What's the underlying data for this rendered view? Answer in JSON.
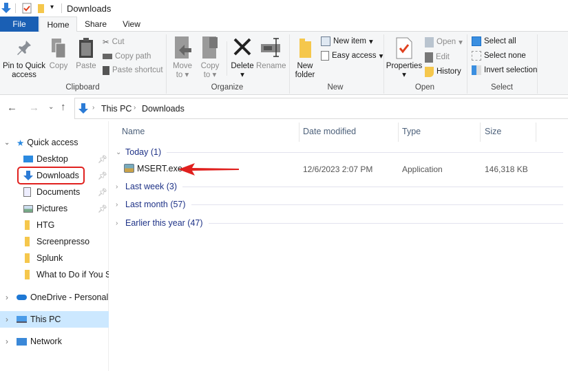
{
  "window": {
    "title": "Downloads"
  },
  "tabs": [
    {
      "label": "File"
    },
    {
      "label": "Home"
    },
    {
      "label": "Share"
    },
    {
      "label": "View"
    }
  ],
  "ribbon": {
    "clipboard": {
      "label": "Clipboard",
      "pin": "Pin to Quick access",
      "pin_l1": "Pin to Quick",
      "pin_l2": "access",
      "copy": "Copy",
      "paste": "Paste",
      "cut": "Cut",
      "copy_path": "Copy path",
      "paste_shortcut": "Paste shortcut"
    },
    "organize": {
      "label": "Organize",
      "move_to_l1": "Move",
      "move_to_l2": "to",
      "copy_to_l1": "Copy",
      "copy_to_l2": "to",
      "delete": "Delete",
      "rename": "Rename"
    },
    "new": {
      "label": "New",
      "new_folder_l1": "New",
      "new_folder_l2": "folder",
      "new_item": "New item",
      "easy_access": "Easy access"
    },
    "open": {
      "label": "Open",
      "properties": "Properties",
      "open": "Open",
      "edit": "Edit",
      "history": "History"
    },
    "select": {
      "label": "Select",
      "select_all": "Select all",
      "select_none": "Select none",
      "invert": "Invert selection"
    }
  },
  "address": {
    "crumbs": [
      "This PC",
      "Downloads"
    ]
  },
  "nav": {
    "quick_access": "Quick access",
    "items": [
      {
        "label": "Desktop",
        "pinned": true
      },
      {
        "label": "Downloads",
        "pinned": true
      },
      {
        "label": "Documents",
        "pinned": true
      },
      {
        "label": "Pictures",
        "pinned": true
      },
      {
        "label": "HTG"
      },
      {
        "label": "Screenpresso"
      },
      {
        "label": "Splunk"
      },
      {
        "label": "What to Do if You S"
      }
    ],
    "onedrive": "OneDrive - Personal",
    "this_pc": "This PC",
    "network": "Network"
  },
  "columns": {
    "name": "Name",
    "date": "Date modified",
    "type": "Type",
    "size": "Size"
  },
  "groups": [
    {
      "label": "Today (1)"
    },
    {
      "label": "Last week (3)"
    },
    {
      "label": "Last month (57)"
    },
    {
      "label": "Earlier this year (47)"
    }
  ],
  "files": [
    {
      "name": "MSERT.exe",
      "date": "12/6/2023 2:07 PM",
      "type": "Application",
      "size": "146,318 KB"
    }
  ],
  "colors": {
    "accent": "#1a5fb4",
    "highlight": "#cce8ff",
    "annotation": "#e0201e"
  }
}
